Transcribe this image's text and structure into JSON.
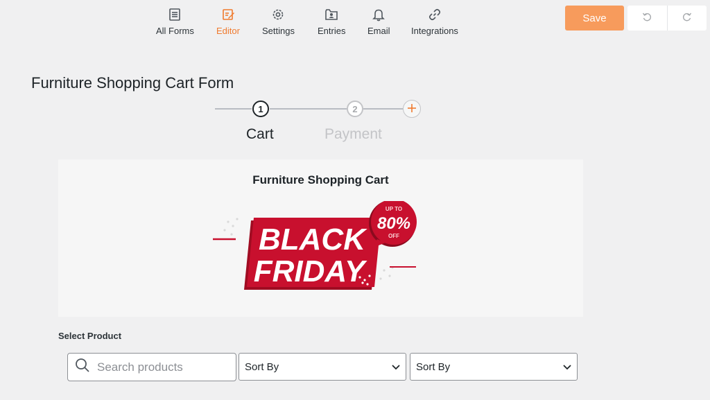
{
  "nav": {
    "items": [
      {
        "label": "All Forms",
        "icon": "forms-icon",
        "active": false
      },
      {
        "label": "Editor",
        "icon": "editor-icon",
        "active": true
      },
      {
        "label": "Settings",
        "icon": "gear-icon",
        "active": false
      },
      {
        "label": "Entries",
        "icon": "entries-icon",
        "active": false
      },
      {
        "label": "Email",
        "icon": "bell-icon",
        "active": false
      },
      {
        "label": "Integrations",
        "icon": "link-icon",
        "active": false
      }
    ]
  },
  "toolbar": {
    "save_label": "Save",
    "undo_icon": "undo-icon",
    "redo_icon": "redo-icon"
  },
  "form": {
    "title": "Furniture Shopping Cart Form",
    "steps": [
      {
        "number": "1",
        "label": "Cart",
        "active": true
      },
      {
        "number": "2",
        "label": "Payment",
        "active": false
      }
    ],
    "add_step_icon": "plus-icon"
  },
  "canvas": {
    "heading": "Furniture Shopping Cart",
    "banner": {
      "line1": "BLACK",
      "line2": "FRIDAY",
      "badge_top": "UP TO",
      "badge_value": "80%",
      "badge_bottom": "OFF"
    }
  },
  "product": {
    "section_label": "Select Product",
    "search_placeholder": "Search products",
    "sort1": "Sort By",
    "sort2": "Sort By"
  },
  "colors": {
    "accent": "#f07a2e",
    "save": "#f79b5c",
    "banner_red": "#c8102e"
  }
}
